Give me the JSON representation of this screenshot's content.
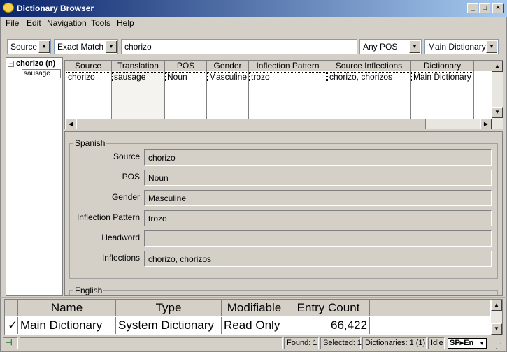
{
  "window": {
    "title": "Dictionary Browser"
  },
  "menu": [
    "File",
    "Edit",
    "Navigation",
    "Tools",
    "Help"
  ],
  "search": {
    "direction": "Source",
    "match": "Exact Match",
    "query": "chorizo",
    "pos": "Any POS",
    "dictionary": "Main Dictionary"
  },
  "tree": {
    "entry": "chorizo (n)",
    "child": "sausage"
  },
  "grid": {
    "columns": [
      "Source",
      "Translation",
      "POS",
      "Gender",
      "Inflection Pattern",
      "Source Inflections",
      "Dictionary"
    ],
    "row": [
      "chorizo",
      "sausage",
      "Noun",
      "Masculine",
      "trozo",
      "chorizo, chorizos",
      "Main Dictionary"
    ]
  },
  "detail": {
    "spanish_label": "Spanish",
    "english_label": "English",
    "fields": [
      {
        "label": "Source",
        "value": "chorizo"
      },
      {
        "label": "POS",
        "value": "Noun"
      },
      {
        "label": "Gender",
        "value": "Masculine"
      },
      {
        "label": "Inflection Pattern",
        "value": "trozo"
      },
      {
        "label": "Headword",
        "value": ""
      },
      {
        "label": "Inflections",
        "value": "chorizo, chorizos"
      }
    ]
  },
  "dictionaries": {
    "columns": [
      "Name",
      "Type",
      "Modifiable",
      "Entry Count"
    ],
    "rows": [
      {
        "check": "✓",
        "name": "Main Dictionary",
        "type": "System Dictionary",
        "modifiable": "Read Only",
        "count": "66,422"
      }
    ]
  },
  "status": {
    "found": "Found: 1",
    "selected": "Selected: 1",
    "dicts": "Dictionaries: 1 (1)",
    "state": "Idle",
    "lang": "SP▸En"
  }
}
